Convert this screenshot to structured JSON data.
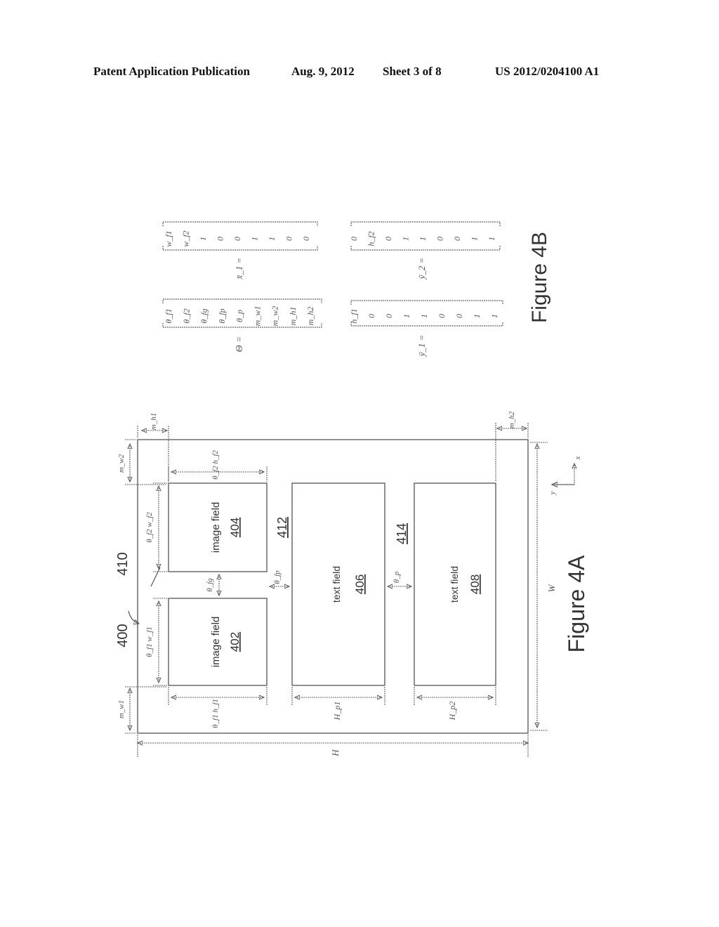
{
  "header": {
    "publication_type": "Patent Application Publication",
    "date": "Aug. 9, 2012",
    "sheet": "Sheet 3 of 8",
    "patent_number": "US 2012/0204100 A1"
  },
  "figure_4a": {
    "caption": "Figure 4A",
    "ref_page": "400",
    "ref_gap": "410",
    "ref_region_412": "412",
    "ref_region_414": "414",
    "fields": [
      {
        "label": "image field",
        "ref": "404"
      },
      {
        "label": "image field",
        "ref": "402"
      },
      {
        "label": "text field",
        "ref": "406"
      },
      {
        "label": "text field",
        "ref": "408"
      }
    ],
    "dimensions": {
      "page_height": "H",
      "page_width": "W",
      "margin_w1": "m_w1",
      "margin_w2": "m_w2",
      "margin_h1": "m_h1",
      "margin_h2": "m_h2",
      "img1_width": "θ_f1 w_f1",
      "img2_width": "θ_f2 w_f2",
      "img1_height": "θ_f1 h_f1",
      "img2_height": "θ_f2 h_f2",
      "text1_height": "H_p1",
      "text2_height": "H_p2",
      "gap_fg": "θ_fg",
      "gap_fp": "θ_fp",
      "gap_p": "θ_p"
    },
    "axes": {
      "x": "x",
      "y": "y"
    }
  },
  "figure_4b": {
    "caption": "Figure 4B",
    "theta": {
      "name": "Θ =",
      "entries": [
        "θ_f1",
        "θ_f2",
        "θ_fg",
        "θ_fp",
        "θ_p",
        "m_w1",
        "m_w2",
        "m_h1",
        "m_h2"
      ]
    },
    "x1": {
      "name": "x̄_1 =",
      "entries": [
        "w_f1",
        "w_f2",
        "1",
        "0",
        "0",
        "1",
        "1",
        "0",
        "0"
      ]
    },
    "y1": {
      "name": "ȳ_1 =",
      "entries": [
        "h_f1",
        "0",
        "0",
        "1",
        "1",
        "0",
        "0",
        "1",
        "1"
      ]
    },
    "y2": {
      "name": "ȳ_2 =",
      "entries": [
        "0",
        "h_f2",
        "0",
        "1",
        "1",
        "0",
        "0",
        "1",
        "1"
      ]
    }
  }
}
